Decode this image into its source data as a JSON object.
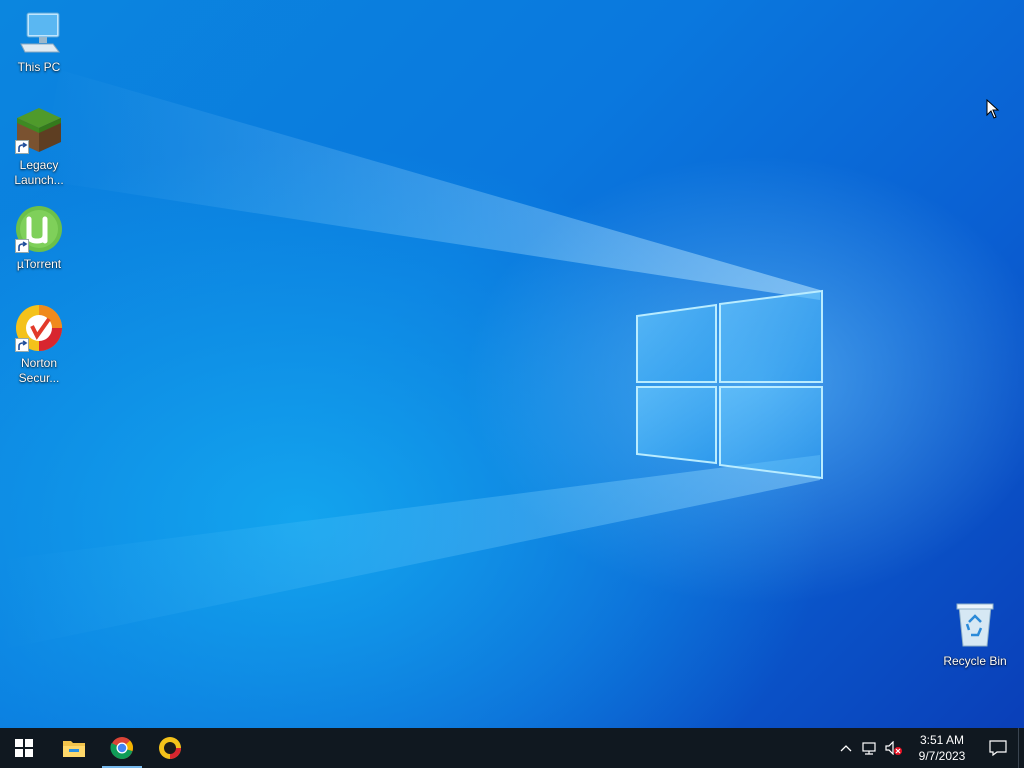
{
  "desktop_icons": [
    {
      "label": "This PC"
    },
    {
      "label": "Legacy Launch..."
    },
    {
      "label": "µTorrent"
    },
    {
      "label": "Norton Secur..."
    },
    {
      "label": "Recycle Bin"
    }
  ],
  "taskbar": {
    "apps": [
      "start-icon",
      "file-explorer-icon",
      "chrome-icon",
      "norton-icon"
    ],
    "clock": {
      "time": "3:51 AM",
      "date": "9/7/2023"
    }
  },
  "colors": {
    "taskbar_bg": "#101820",
    "accent": "#76b9ed"
  }
}
